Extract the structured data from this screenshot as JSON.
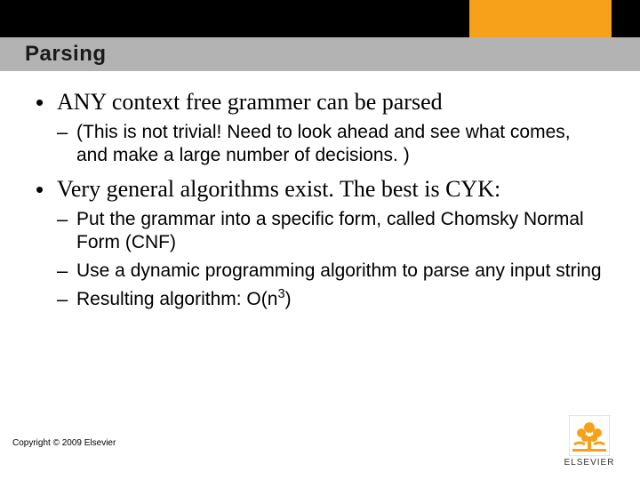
{
  "header": {
    "title": "Parsing"
  },
  "bullets": [
    {
      "text": "ANY context free grammer can be parsed",
      "sub": [
        {
          "text": "(This is not trivial!  Need to look ahead and see what comes, and make a large number of decisions. )"
        }
      ]
    },
    {
      "text": "Very general algorithms exist.  The best is CYK:",
      "sub": [
        {
          "text": "Put the grammar into a specific form, called Chomsky Normal Form (CNF)"
        },
        {
          "text": "Use a dynamic programming algorithm to parse any input string"
        },
        {
          "text_pre": "Resulting algorithm: O(n",
          "sup": "3",
          "text_post": ")"
        }
      ]
    }
  ],
  "footer": {
    "copyright": "Copyright © 2009 Elsevier",
    "publisher": "ELSEVIER"
  },
  "colors": {
    "accent_orange": "#f7a11a",
    "title_bar": "#b3b3b3",
    "logo_orange": "#f7a11a"
  }
}
